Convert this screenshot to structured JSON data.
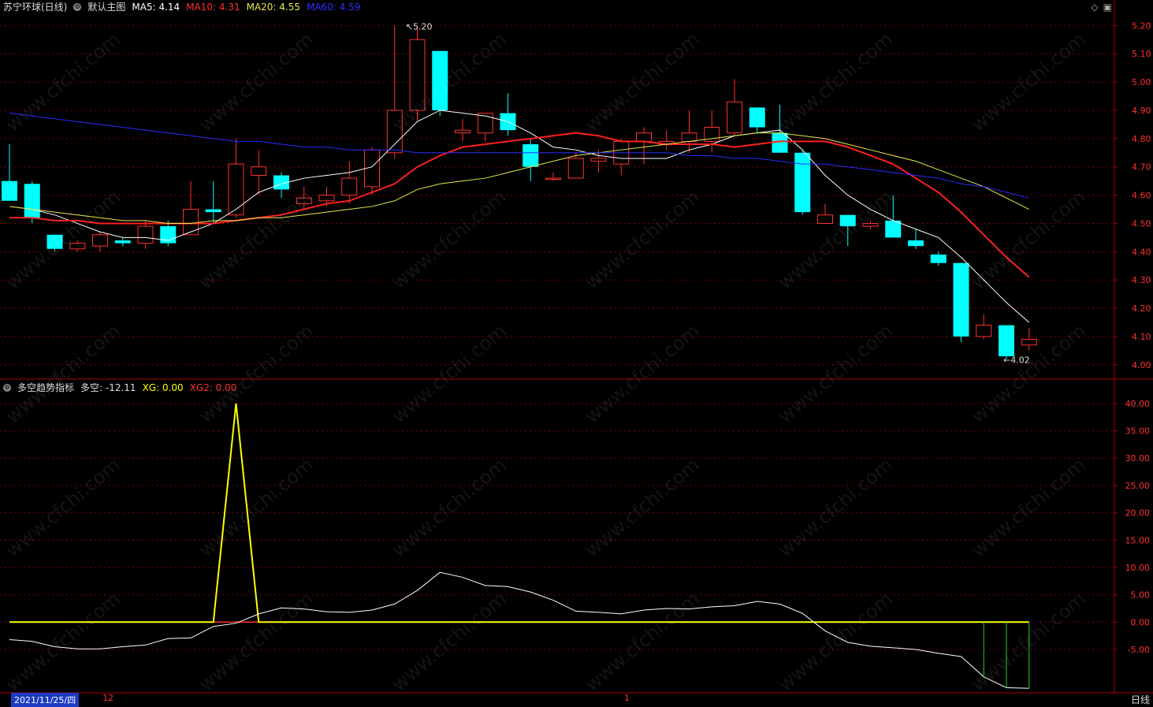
{
  "stock": {
    "title": "苏宁环球(日线)",
    "main_label": "默认主图",
    "ma5_label": "MA5: 4.14",
    "ma10_label": "MA10: 4.31",
    "ma20_label": "MA20: 4.55",
    "ma60_label": "MA60: 4.59"
  },
  "indicator": {
    "name": "多空趋势指标",
    "value_label": "多空: -12.11",
    "xg_label": "XG: 0.00",
    "xg2_label": "XG2: 0.00"
  },
  "annotations": {
    "high": "5.20",
    "low": "4.02"
  },
  "status_bar": {
    "date": "2021/11/25/四",
    "month_mark_1": "12",
    "month_mark_2": "1",
    "period": "日线"
  },
  "watermark": "www.cfchi.com",
  "colors": {
    "up": "#ff3030",
    "down": "#00ffff",
    "ma5": "#ffffff",
    "ma10": "#ff2020",
    "ma20": "#e8e84a",
    "ma60": "#2a2aff",
    "axis": "#b00000",
    "grid": "#7a0000",
    "osc": "#ffffff",
    "xg": "#ffff00",
    "xg2": "#ff3030",
    "bar": "#22cc22"
  },
  "chart_data": [
    {
      "type": "candlestick",
      "title": "苏宁环球(日线)",
      "ylim": [
        3.98,
        5.24
      ],
      "y_ticks": [
        4.0,
        4.1,
        4.2,
        4.3,
        4.4,
        4.5,
        4.6,
        4.7,
        4.8,
        4.9,
        5.0,
        5.1,
        5.2
      ],
      "candles": [
        [
          4.65,
          4.58,
          4.78,
          4.58
        ],
        [
          4.64,
          4.52,
          4.65,
          4.5
        ],
        [
          4.46,
          4.41,
          4.46,
          4.4
        ],
        [
          4.41,
          4.43,
          4.44,
          4.4
        ],
        [
          4.42,
          4.46,
          4.47,
          4.4
        ],
        [
          4.44,
          4.43,
          4.45,
          4.42
        ],
        [
          4.43,
          4.49,
          4.51,
          4.41
        ],
        [
          4.49,
          4.43,
          4.51,
          4.42
        ],
        [
          4.46,
          4.55,
          4.65,
          4.46
        ],
        [
          4.55,
          4.54,
          4.65,
          4.5
        ],
        [
          4.53,
          4.71,
          4.8,
          4.52
        ],
        [
          4.67,
          4.7,
          4.76,
          4.6
        ],
        [
          4.67,
          4.62,
          4.68,
          4.59
        ],
        [
          4.57,
          4.59,
          4.63,
          4.55
        ],
        [
          4.58,
          4.6,
          4.63,
          4.56
        ],
        [
          4.6,
          4.66,
          4.72,
          4.57
        ],
        [
          4.63,
          4.76,
          4.77,
          4.6
        ],
        [
          4.75,
          4.9,
          5.2,
          4.73
        ],
        [
          4.9,
          5.15,
          5.19,
          4.86
        ],
        [
          5.11,
          4.9,
          5.11,
          4.88
        ],
        [
          4.82,
          4.83,
          4.87,
          4.79
        ],
        [
          4.82,
          4.89,
          4.89,
          4.79
        ],
        [
          4.89,
          4.83,
          4.96,
          4.81
        ],
        [
          4.78,
          4.7,
          4.8,
          4.65
        ],
        [
          4.66,
          4.66,
          4.68,
          4.65
        ],
        [
          4.66,
          4.73,
          4.75,
          4.66
        ],
        [
          4.72,
          4.73,
          4.76,
          4.68
        ],
        [
          4.71,
          4.79,
          4.8,
          4.67
        ],
        [
          4.79,
          4.82,
          4.84,
          4.71
        ],
        [
          4.78,
          4.79,
          4.83,
          4.76
        ],
        [
          4.79,
          4.82,
          4.9,
          4.75
        ],
        [
          4.79,
          4.84,
          4.9,
          4.75
        ],
        [
          4.82,
          4.93,
          5.01,
          4.81
        ],
        [
          4.91,
          4.84,
          4.91,
          4.82
        ],
        [
          4.82,
          4.75,
          4.92,
          4.75
        ],
        [
          4.75,
          4.54,
          4.76,
          4.53
        ],
        [
          4.5,
          4.53,
          4.57,
          4.5
        ],
        [
          4.53,
          4.49,
          4.53,
          4.42
        ],
        [
          4.49,
          4.5,
          4.51,
          4.48
        ],
        [
          4.51,
          4.45,
          4.6,
          4.45
        ],
        [
          4.44,
          4.42,
          4.48,
          4.41
        ],
        [
          4.39,
          4.36,
          4.4,
          4.35
        ],
        [
          4.36,
          4.1,
          4.36,
          4.08
        ],
        [
          4.1,
          4.14,
          4.18,
          4.09
        ],
        [
          4.14,
          4.03,
          4.14,
          4.02
        ],
        [
          4.07,
          4.09,
          4.13,
          4.05
        ]
      ],
      "series": [
        {
          "name": "MA5",
          "values": [
            4.56,
            4.55,
            4.53,
            4.5,
            4.47,
            4.45,
            4.45,
            4.44,
            4.47,
            4.5,
            4.55,
            4.61,
            4.64,
            4.66,
            4.67,
            4.68,
            4.7,
            4.78,
            4.86,
            4.9,
            4.89,
            4.88,
            4.86,
            4.82,
            4.77,
            4.76,
            4.74,
            4.73,
            4.73,
            4.73,
            4.76,
            4.78,
            4.81,
            4.82,
            4.83,
            4.76,
            4.67,
            4.6,
            4.55,
            4.51,
            4.48,
            4.45,
            4.38,
            4.3,
            4.22,
            4.15
          ]
        },
        {
          "name": "MA10",
          "values": [
            4.52,
            4.52,
            4.51,
            4.51,
            4.5,
            4.5,
            4.5,
            4.5,
            4.5,
            4.5,
            4.51,
            4.52,
            4.53,
            4.55,
            4.57,
            4.58,
            4.61,
            4.64,
            4.7,
            4.74,
            4.77,
            4.78,
            4.79,
            4.8,
            4.81,
            4.82,
            4.81,
            4.79,
            4.79,
            4.78,
            4.78,
            4.78,
            4.77,
            4.78,
            4.79,
            4.79,
            4.79,
            4.77,
            4.74,
            4.71,
            4.66,
            4.61,
            4.54,
            4.46,
            4.38,
            4.31
          ]
        },
        {
          "name": "MA20",
          "values": [
            4.56,
            4.55,
            4.54,
            4.53,
            4.52,
            4.51,
            4.51,
            4.5,
            4.5,
            4.51,
            4.51,
            4.52,
            4.52,
            4.53,
            4.54,
            4.55,
            4.56,
            4.58,
            4.62,
            4.64,
            4.65,
            4.66,
            4.68,
            4.7,
            4.72,
            4.74,
            4.75,
            4.76,
            4.77,
            4.78,
            4.79,
            4.8,
            4.81,
            4.82,
            4.82,
            4.81,
            4.8,
            4.78,
            4.76,
            4.74,
            4.72,
            4.69,
            4.66,
            4.63,
            4.59,
            4.55
          ]
        },
        {
          "name": "MA60",
          "values": [
            4.89,
            4.88,
            4.87,
            4.86,
            4.85,
            4.84,
            4.83,
            4.82,
            4.81,
            4.8,
            4.79,
            4.79,
            4.78,
            4.77,
            4.77,
            4.76,
            4.76,
            4.76,
            4.75,
            4.75,
            4.75,
            4.75,
            4.75,
            4.75,
            4.75,
            4.75,
            4.75,
            4.75,
            4.75,
            4.75,
            4.74,
            4.74,
            4.73,
            4.73,
            4.72,
            4.71,
            4.71,
            4.7,
            4.69,
            4.68,
            4.67,
            4.66,
            4.64,
            4.63,
            4.61,
            4.59
          ]
        }
      ]
    },
    {
      "type": "line",
      "title": "多空趋势指标",
      "ylim": [
        -12.5,
        42
      ],
      "y_ticks": [
        -5,
        0,
        5,
        10,
        15,
        20,
        25,
        30,
        35,
        40
      ],
      "series": [
        {
          "name": "多空",
          "values": [
            -3.2,
            -3.5,
            -4.5,
            -4.9,
            -4.9,
            -4.5,
            -4.2,
            -3.0,
            -2.9,
            -0.8,
            -0.2,
            1.5,
            2.6,
            2.4,
            1.9,
            1.8,
            2.2,
            3.3,
            5.8,
            9.1,
            8.2,
            6.7,
            6.5,
            5.5,
            4.0,
            2.0,
            1.8,
            1.5,
            2.2,
            2.5,
            2.4,
            2.8,
            3.0,
            3.8,
            3.3,
            1.6,
            -1.6,
            -3.7,
            -4.4,
            -4.7,
            -5.0,
            -5.7,
            -6.3,
            -10.0,
            -12.0,
            -12.1
          ]
        },
        {
          "name": "XG",
          "values": [
            0,
            0,
            0,
            0,
            0,
            0,
            0,
            0,
            0,
            0,
            40,
            0,
            0,
            0,
            0,
            0,
            0,
            0,
            0,
            0,
            0,
            0,
            0,
            0,
            0,
            0,
            0,
            0,
            0,
            0,
            0,
            0,
            0,
            0,
            0,
            0,
            0,
            0,
            0,
            0,
            0,
            0,
            0,
            0,
            0,
            0
          ]
        },
        {
          "name": "XG2",
          "values": [
            0,
            0,
            0,
            0,
            0,
            0,
            0,
            0,
            0,
            0,
            0,
            0,
            0,
            0,
            0,
            0,
            0,
            0,
            0,
            0,
            0,
            0,
            0,
            0,
            0,
            0,
            0,
            0,
            0,
            0,
            0,
            0,
            0,
            0,
            0,
            0,
            0,
            0,
            0,
            0,
            0,
            0,
            0,
            0,
            0,
            0
          ]
        }
      ],
      "bars_at": [
        43,
        44,
        45
      ]
    }
  ]
}
